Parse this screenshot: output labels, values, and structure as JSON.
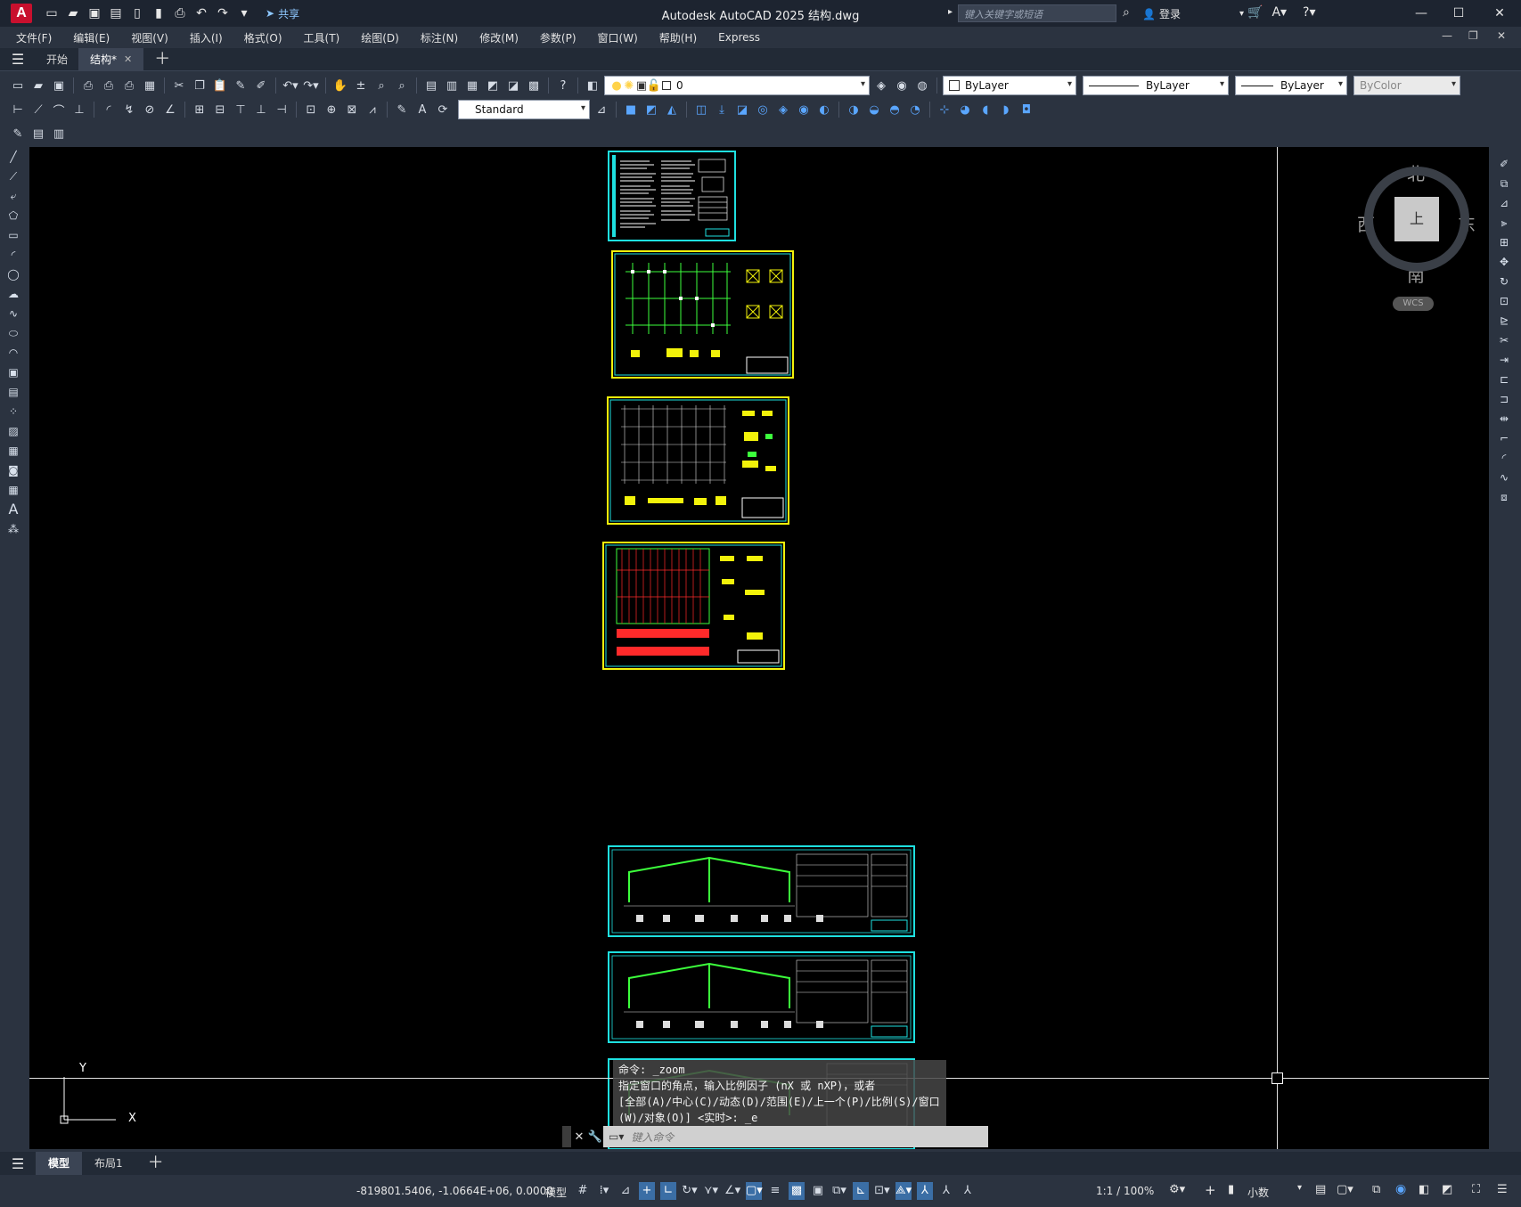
{
  "titlebar": {
    "title": "Autodesk AutoCAD 2025    结构.dwg",
    "logo": "A",
    "share_label": "共享",
    "search_placeholder": "键入关键字或短语",
    "login_label": "登录"
  },
  "menu": [
    "文件(F)",
    "编辑(E)",
    "视图(V)",
    "插入(I)",
    "格式(O)",
    "工具(T)",
    "绘图(D)",
    "标注(N)",
    "修改(M)",
    "参数(P)",
    "窗口(W)",
    "帮助(H)",
    "Express"
  ],
  "doc_tabs": [
    {
      "label": "开始",
      "active": false
    },
    {
      "label": "结构*",
      "active": true
    }
  ],
  "layer": {
    "current": "0"
  },
  "properties": {
    "color": "ByLayer",
    "linetype": "ByLayer",
    "lineweight": "ByLayer",
    "plotstyle": "ByColor"
  },
  "dim_style": "Standard",
  "viewcube": {
    "north": "北",
    "south": "南",
    "east": "东",
    "west": "西",
    "face": "上",
    "wcs": "WCS"
  },
  "ucs": {
    "x": "X",
    "y": "Y"
  },
  "command": {
    "history": [
      "命令: _zoom",
      "指定窗口的角点，输入比例因子 (nX 或 nXP)，或者",
      "[全部(A)/中心(C)/动态(D)/范围(E)/上一个(P)/比例(S)/窗口",
      "(W)/对象(O)] <实时>: _e"
    ],
    "input_placeholder": "键入命令"
  },
  "layout_tabs": [
    {
      "label": "模型",
      "active": true
    },
    {
      "label": "布局1",
      "active": false
    }
  ],
  "status": {
    "coords": "-819801.5406, -1.0664E+06, 0.0000",
    "mode": "模型",
    "scale": "1:1 / 100%",
    "units": "小数"
  },
  "colors": {
    "sheet_border_cyan": "#1ee0e0",
    "sheet_border_yellow": "#f2f20a",
    "drawing_green": "#3cff3c",
    "drawing_red": "#ff2a2a",
    "canvas_bg": "#000000"
  }
}
